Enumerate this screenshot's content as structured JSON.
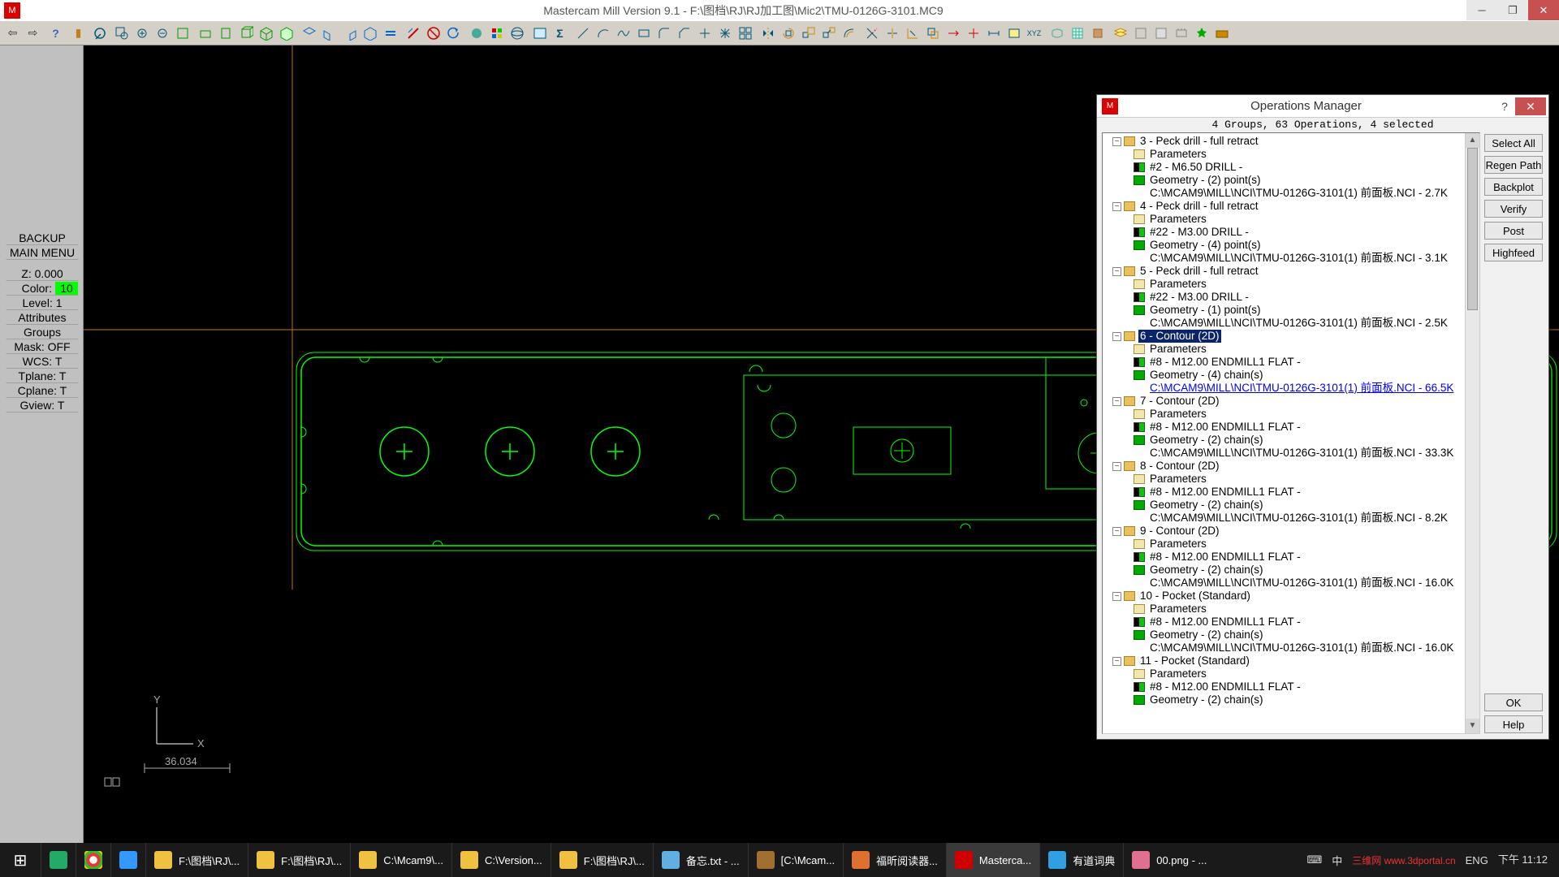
{
  "window": {
    "title": "Mastercam Mill Version 9.1 - F:\\图档\\RJ\\RJ加工图\\Mic2\\TMU-0126G-3101.MC9"
  },
  "side": {
    "backup": "BACKUP",
    "mainmenu": "MAIN MENU",
    "z": "Z:   0.000",
    "color_label": "Color:",
    "color_value": "10",
    "level": "Level:   1",
    "attributes": "Attributes",
    "groups": "Groups",
    "mask": "Mask: OFF",
    "wcs": "WCS:   T",
    "tplane": "Tplane:   T",
    "cplane": "Cplane:   T",
    "gview": "Gview:   T"
  },
  "scale_value": "36.034",
  "axis": {
    "x": "X",
    "y": "Y"
  },
  "ops": {
    "title": "Operations Manager",
    "status": "4 Groups, 63 Operations, 4 selected",
    "buttons": {
      "select_all": "Select All",
      "regen": "Regen Path",
      "backplot": "Backplot",
      "verify": "Verify",
      "post": "Post",
      "highfeed": "Highfeed",
      "ok": "OK",
      "help": "Help"
    },
    "tree": [
      {
        "id": 3,
        "title": "3 - Peck drill - full retract",
        "params": "Parameters",
        "tool": "#2 - M6.50 DRILL -",
        "geom": "Geometry - (2) point(s)",
        "nci": "C:\\MCAM9\\MILL\\NCI\\TMU-0126G-3101(1) 前面板.NCI - 2.7K"
      },
      {
        "id": 4,
        "title": "4 - Peck drill - full retract",
        "params": "Parameters",
        "tool": "#22 - M3.00 DRILL -",
        "geom": "Geometry - (4) point(s)",
        "nci": "C:\\MCAM9\\MILL\\NCI\\TMU-0126G-3101(1) 前面板.NCI - 3.1K"
      },
      {
        "id": 5,
        "title": "5 - Peck drill - full retract",
        "params": "Parameters",
        "tool": "#22 - M3.00 DRILL -",
        "geom": "Geometry - (1) point(s)",
        "nci": "C:\\MCAM9\\MILL\\NCI\\TMU-0126G-3101(1) 前面板.NCI - 2.5K"
      },
      {
        "id": 6,
        "title": "6 - Contour (2D)",
        "params": "Parameters",
        "tool": "#8 - M12.00 ENDMILL1 FLAT -",
        "geom": "Geometry - (4) chain(s)",
        "nci": "C:\\MCAM9\\MILL\\NCI\\TMU-0126G-3101(1) 前面板.NCI - 66.5K",
        "selected": true
      },
      {
        "id": 7,
        "title": "7 - Contour (2D)",
        "params": "Parameters",
        "tool": "#8 - M12.00 ENDMILL1 FLAT -",
        "geom": "Geometry - (2) chain(s)",
        "nci": "C:\\MCAM9\\MILL\\NCI\\TMU-0126G-3101(1) 前面板.NCI - 33.3K"
      },
      {
        "id": 8,
        "title": "8 - Contour (2D)",
        "params": "Parameters",
        "tool": "#8 - M12.00 ENDMILL1 FLAT -",
        "geom": "Geometry - (2) chain(s)",
        "nci": "C:\\MCAM9\\MILL\\NCI\\TMU-0126G-3101(1) 前面板.NCI - 8.2K"
      },
      {
        "id": 9,
        "title": "9 - Contour (2D)",
        "params": "Parameters",
        "tool": "#8 - M12.00 ENDMILL1 FLAT -",
        "geom": "Geometry - (2) chain(s)",
        "nci": "C:\\MCAM9\\MILL\\NCI\\TMU-0126G-3101(1) 前面板.NCI - 16.0K"
      },
      {
        "id": 10,
        "title": "10 - Pocket (Standard)",
        "params": "Parameters",
        "tool": "#8 - M12.00 ENDMILL1 FLAT -",
        "geom": "Geometry - (2) chain(s)",
        "nci": "C:\\MCAM9\\MILL\\NCI\\TMU-0126G-3101(1) 前面板.NCI - 16.0K"
      },
      {
        "id": 11,
        "title": "11 - Pocket (Standard)",
        "params": "Parameters",
        "tool": "#8 - M12.00 ENDMILL1 FLAT -",
        "geom": "Geometry - (2) chain(s)"
      }
    ]
  },
  "taskbar": {
    "items": [
      {
        "label": "F:\\图档\\RJ\\...",
        "color": "#f0c040"
      },
      {
        "label": "F:\\图档\\RJ\\...",
        "color": "#f0c040"
      },
      {
        "label": "C:\\Mcam9\\...",
        "color": "#f0c040"
      },
      {
        "label": "C:\\Version...",
        "color": "#f0c040"
      },
      {
        "label": "F:\\图档\\RJ\\...",
        "color": "#f0c040"
      },
      {
        "label": "备忘.txt - ...",
        "color": "#5fb0e0"
      },
      {
        "label": "[C:\\Mcam...",
        "color": "#a07030"
      },
      {
        "label": "福昕阅读器...",
        "color": "#e07030"
      },
      {
        "label": "Masterca...",
        "color": "#d00000",
        "active": true
      },
      {
        "label": "有道词典",
        "color": "#30a0e0"
      },
      {
        "label": "00.png - ...",
        "color": "#e07090"
      }
    ],
    "lang": "中",
    "ime": "ENG",
    "time1": "下午 11:12",
    "watermark": "三维网 www.3dportal.cn"
  }
}
